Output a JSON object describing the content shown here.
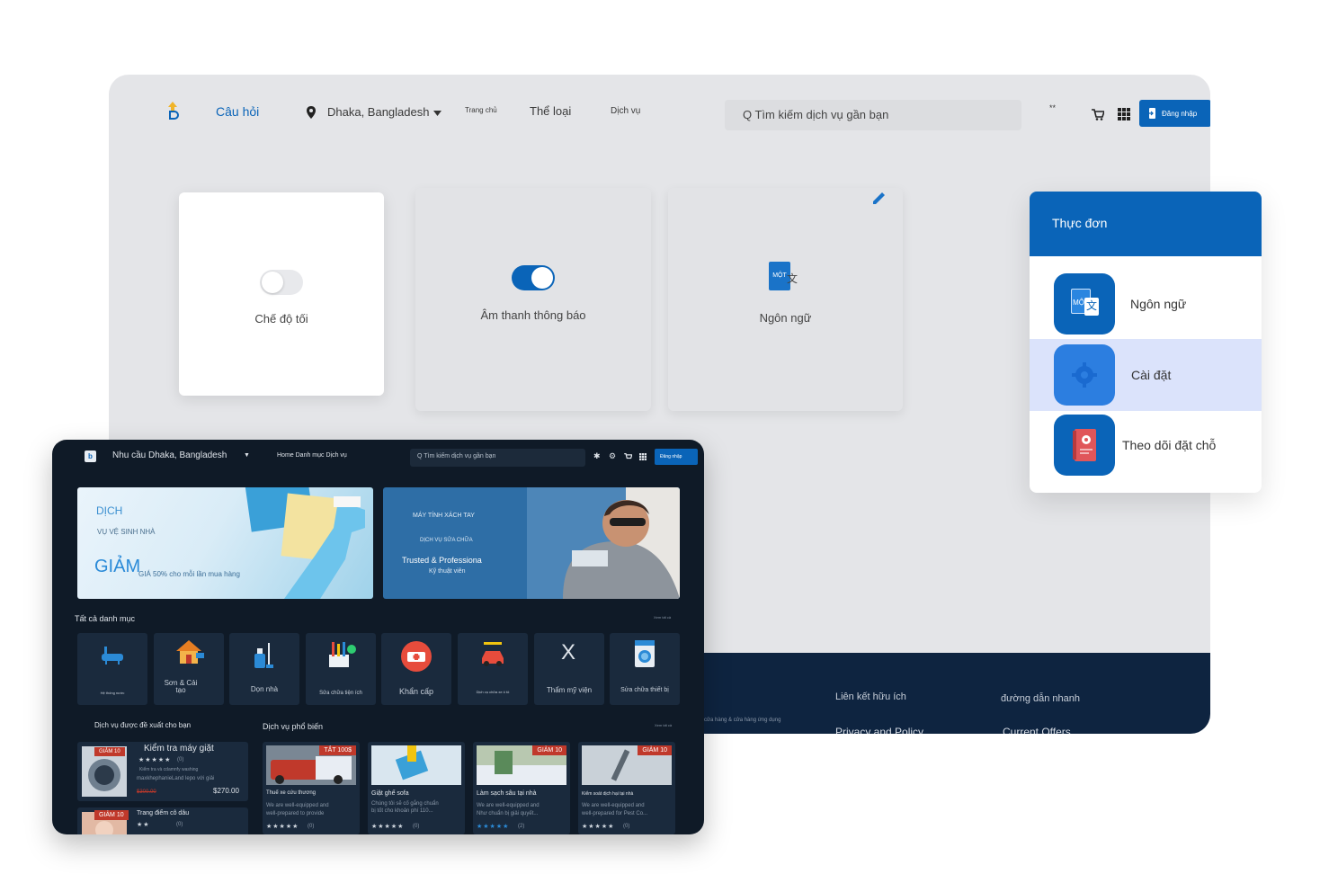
{
  "light": {
    "nav": {
      "faq": "Câu hỏi",
      "location": "Dhaka, Bangladesh",
      "home": "Trang chủ",
      "categories": "Thể loại",
      "services": "Dịch vụ",
      "search_placeholder": "Q Tìm kiếm dịch vụ gần bạn",
      "signin": "Đăng nhập"
    },
    "cards": {
      "dark_mode": "Chế độ tối",
      "notification_sound": "Âm thanh thông báo",
      "language": "Ngôn ngữ",
      "language_icon_text": "MỘT"
    },
    "footer": {
      "links_title": "Liên kết hữu ích",
      "quick_title": "đường dẫn nhanh",
      "small_text": "cửa hàng & cửa hàng ứng dụng",
      "privacy": "Privacy and Policy",
      "offers": "Current Offers"
    }
  },
  "menu": {
    "title": "Thực đơn",
    "items": [
      {
        "label": "Ngôn ngữ",
        "icon_text": "MỘT"
      },
      {
        "label": "Cài đặt"
      },
      {
        "label": "Theo dõi đặt chỗ"
      }
    ]
  },
  "dark": {
    "nav": {
      "location": "Nhu cầu Dhaka, Bangladesh",
      "links": "Home Danh mục Dịch vụ",
      "search_placeholder": "Q Tìm kiếm dịch vụ gần bạn",
      "signin": "Đăng nhập"
    },
    "banner1": {
      "line1": "DỊCH",
      "line2": "VỤ VỆ SINH NHÀ",
      "discount": "GIẢM",
      "discount_text": "GIÁ 50% cho mỗi lần mua hàng"
    },
    "banner2": {
      "line1": "MÁY TÍNH XÁCH TAY",
      "line2": "DỊCH VỤ SỬA CHỮA",
      "line3": "Trusted & Professiona",
      "line4": "Kỹ thuật viên"
    },
    "categories_title": "Tất cả danh mục",
    "see_all": "Xem tất cả",
    "categories": [
      {
        "label": "Hệ thống nước"
      },
      {
        "label": "Sơn & Cải tạo"
      },
      {
        "label": "Dọn nhà"
      },
      {
        "label": "Sửa chữa tiện ích"
      },
      {
        "label": "Khẩn cấp"
      },
      {
        "label": "Dịch vụ chữa xe ô tô"
      },
      {
        "label": "Thẩm mỹ viện"
      },
      {
        "label": "Sửa chữa thiết bị"
      }
    ],
    "recommended_title": "Dịch vụ được đề xuất cho bạn",
    "popular_title": "Dịch vụ phổ biến",
    "recommended": [
      {
        "ribbon": "GIẢM 10",
        "title": "Kiểm tra máy giặt",
        "rating": "★★★★★",
        "count": "(0)",
        "desc1": "Kiểm tra và cdamnfy washing",
        "desc2": "maxkhephanieLand lepo với giải",
        "old_price": "$300.00",
        "price": "$270.00"
      },
      {
        "ribbon": "GIẢM 10",
        "title": "Trang điểm cô dâu",
        "rating": "★★",
        "count": "(0)"
      }
    ],
    "popular": [
      {
        "ribbon": "TẮT 100$",
        "title": "Thuế xe cứu thương",
        "desc1": "We are well-equipped and",
        "desc2": "well-prepared to provide",
        "rating": "★★★★★",
        "count": "(0)"
      },
      {
        "title": "Giặt ghế sofa",
        "desc1": "Chúng tôi sẽ cố gắng chuẩn",
        "desc2": "bị tốt cho khoản phí 110...",
        "rating": "★★★★★",
        "count": "(0)"
      },
      {
        "ribbon": "GIẢM 10",
        "title": "Làm sạch sâu tại nhà",
        "desc1": "We are well-equipped and",
        "desc2": "Như chuẩn bị giải quyết...",
        "rating": "★★★★★",
        "count": "(2)"
      },
      {
        "ribbon": "GIẢM 10",
        "title": "Kiểm soát dịch hại tại nhà",
        "desc1": "We are well-equipped and",
        "desc2": "well-prepared for Pest Co...",
        "rating": "★★★★★",
        "count": "(0)"
      }
    ]
  },
  "colors": {
    "brand_blue": "#0a64b8",
    "dark_bg": "#0f1a27",
    "light_bg": "#e4e5e8",
    "footer_bg": "#0e2440",
    "highlight": "#dbe3fb",
    "ribbon_red": "#c0392b"
  }
}
